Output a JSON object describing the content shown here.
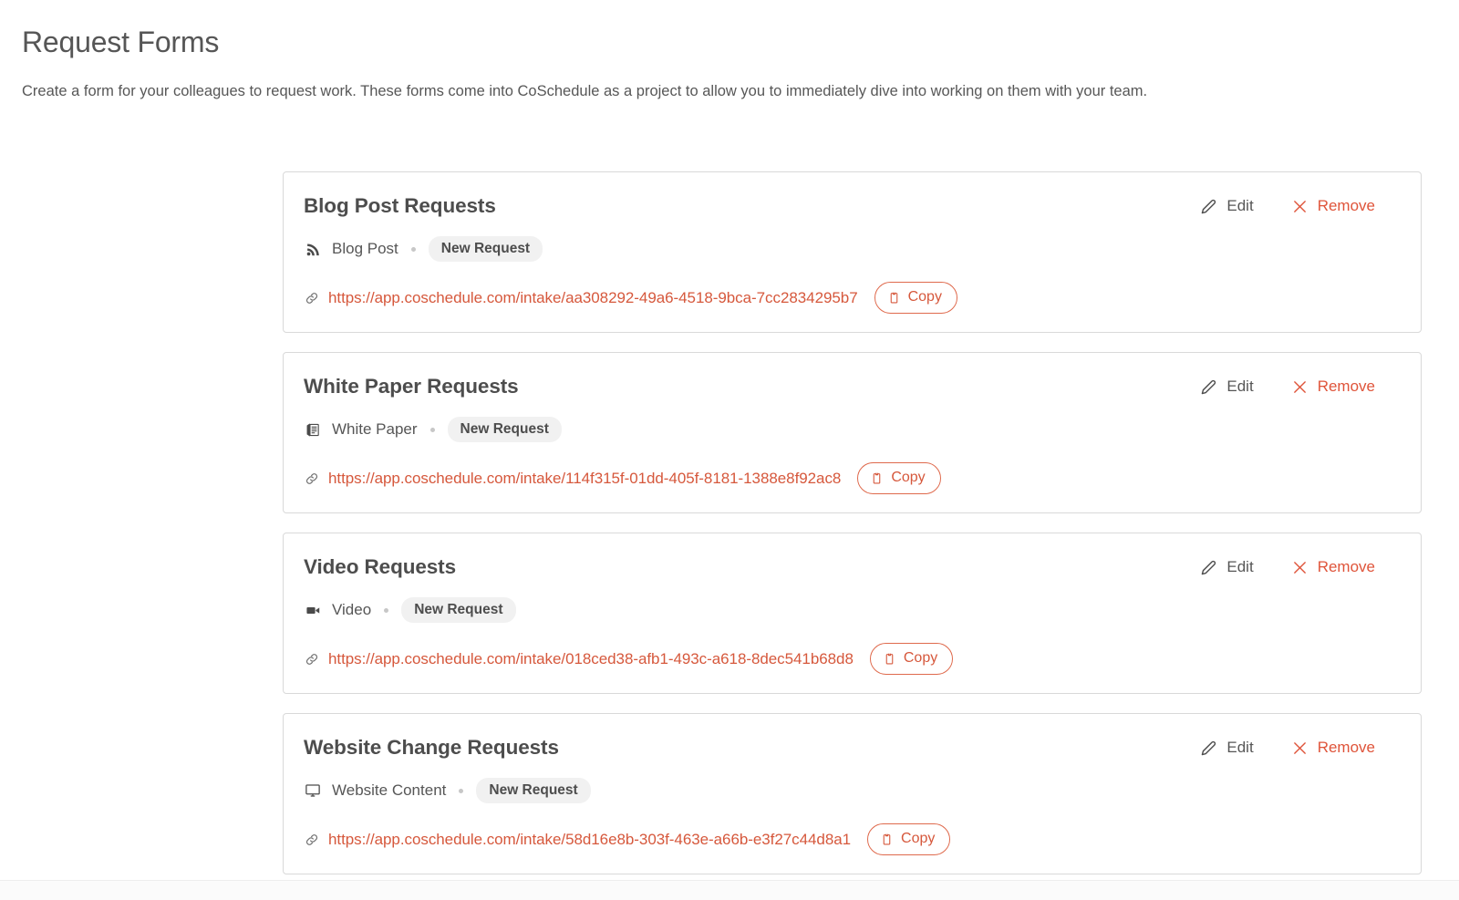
{
  "header": {
    "title": "Request Forms",
    "description": "Create a form for your colleagues to request work. These forms come into CoSchedule as a project to allow you to immediately dive into working on them with your team."
  },
  "actions": {
    "edit_label": "Edit",
    "remove_label": "Remove",
    "copy_label": "Copy"
  },
  "colors": {
    "accent": "#d6583c",
    "title_text": "#4d4d4d",
    "body_text": "#565656",
    "badge_bg": "#f1f1f1",
    "card_border": "#d9d9d9"
  },
  "forms": [
    {
      "title": "Blog Post Requests",
      "type_icon": "rss-icon",
      "type_label": "Blog Post",
      "badge": "New Request",
      "url": "https://app.coschedule.com/intake/aa308292-49a6-4518-9bca-7cc2834295b7"
    },
    {
      "title": "White Paper Requests",
      "type_icon": "document-stack-icon",
      "type_label": "White Paper",
      "badge": "New Request",
      "url": "https://app.coschedule.com/intake/114f315f-01dd-405f-8181-1388e8f92ac8"
    },
    {
      "title": "Video Requests",
      "type_icon": "video-camera-icon",
      "type_label": "Video",
      "badge": "New Request",
      "url": "https://app.coschedule.com/intake/018ced38-afb1-493c-a618-8dec541b68d8"
    },
    {
      "title": "Website Change Requests",
      "type_icon": "monitor-icon",
      "type_label": "Website Content",
      "badge": "New Request",
      "url": "https://app.coschedule.com/intake/58d16e8b-303f-463e-a66b-e3f27c44d8a1"
    }
  ]
}
